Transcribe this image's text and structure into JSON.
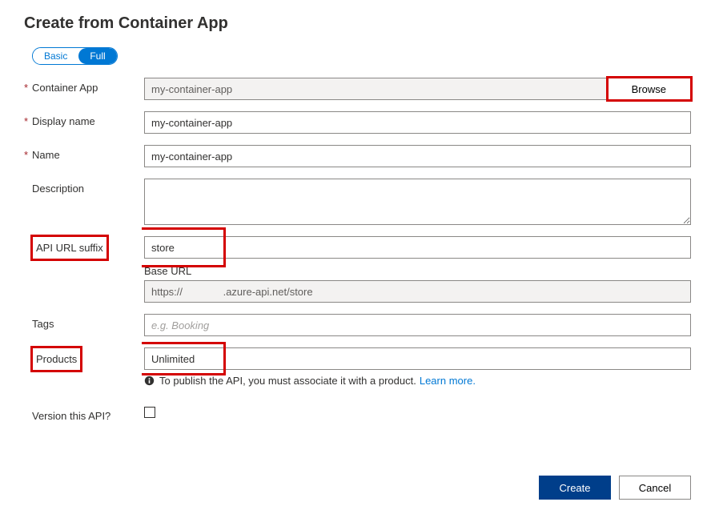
{
  "title": "Create from Container App",
  "toggle": {
    "basic": "Basic",
    "full": "Full"
  },
  "labels": {
    "container_app": "Container App",
    "display_name": "Display name",
    "name": "Name",
    "description": "Description",
    "api_url_suffix": "API URL suffix",
    "base_url": "Base URL",
    "tags": "Tags",
    "products": "Products",
    "version": "Version this API?"
  },
  "values": {
    "container_app": "my-container-app",
    "display_name": "my-container-app",
    "name": "my-container-app",
    "description": "",
    "api_url_suffix": "store",
    "base_url": "https://              .azure-api.net/store",
    "tags": "",
    "products": "Unlimited"
  },
  "placeholders": {
    "tags": "e.g. Booking"
  },
  "buttons": {
    "browse": "Browse",
    "create": "Create",
    "cancel": "Cancel"
  },
  "hint": {
    "text": "To publish the API, you must associate it with a product.",
    "link": "Learn more"
  }
}
